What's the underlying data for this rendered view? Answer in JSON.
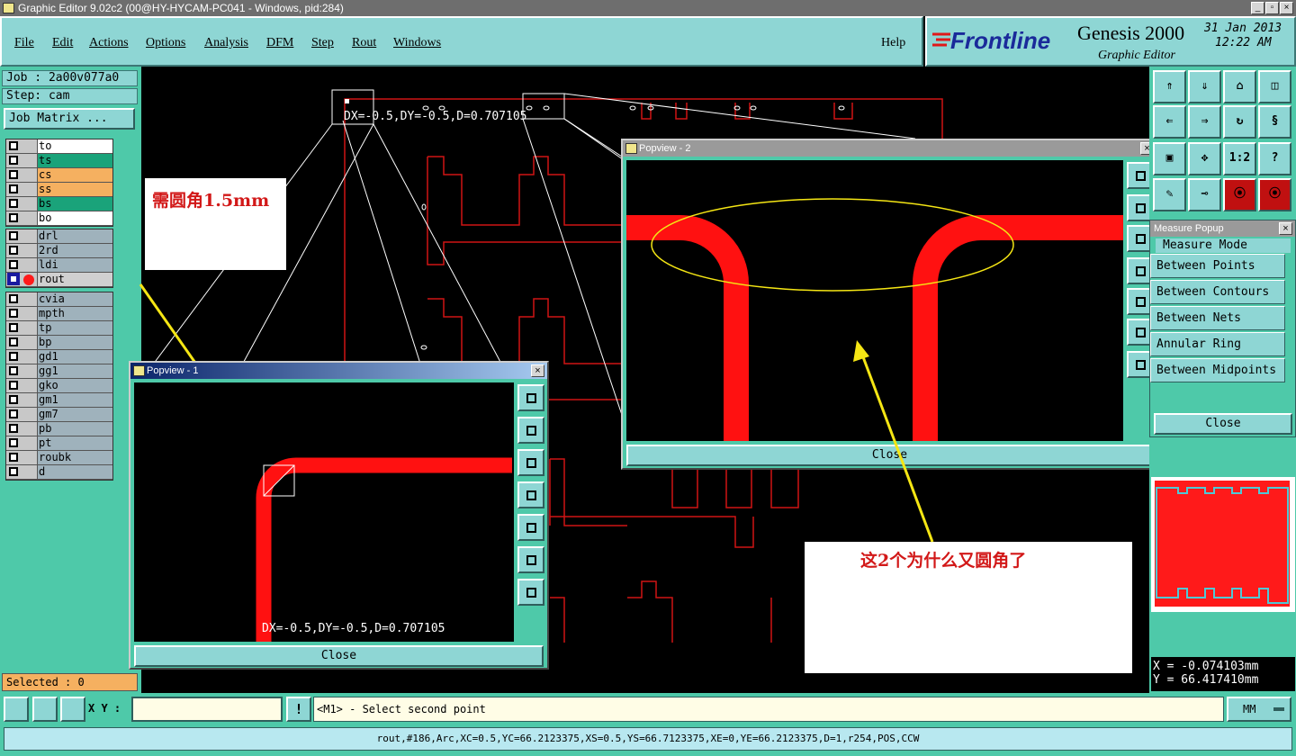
{
  "window": {
    "title": "Graphic Editor 9.02c2 (00@HY-HYCAM-PC041 - Windows, pid:284)"
  },
  "menu": {
    "items": [
      "File",
      "Edit",
      "Actions",
      "Options",
      "Analysis",
      "DFM",
      "Step",
      "Rout",
      "Windows"
    ],
    "help": "Help"
  },
  "brand": {
    "logo": "Frontline",
    "product": "Genesis 2000",
    "subtitle": "Graphic Editor",
    "date": "31 Jan 2013",
    "time": "12:22 AM"
  },
  "job": {
    "job_line": "Job : 2a00v077a0",
    "step_line": "Step: cam",
    "matrix_button": "Job Matrix ..."
  },
  "layers": {
    "group1": [
      "to",
      "ts",
      "cs",
      "ss",
      "bs",
      "bo"
    ],
    "group2": [
      "drl",
      "2rd",
      "ldi",
      "rout"
    ],
    "group3": [
      "cvia",
      "mpth",
      "tp",
      "bp",
      "gd1",
      "gg1",
      "gko",
      "gm1",
      "gm7",
      "pb",
      "pt",
      "roubk",
      "d"
    ],
    "colors": {
      "to": "#ffffff",
      "ts": "#1aa37a",
      "cs": "#f5b060",
      "ss": "#f5b060",
      "bs": "#1aa37a",
      "bo": "#ffffff",
      "drl": "#9fb2bc",
      "2rd": "#9fb2bc",
      "ldi": "#9fb2bc",
      "rout": "#d0d0d0"
    }
  },
  "selected": "Selected : 0",
  "canvas": {
    "measure_text": "DX=-0.5,DY=-0.5,D=0.707105"
  },
  "popview1": {
    "title": "Popview - 1",
    "measure_text": "DX=-0.5,DY=-0.5,D=0.707105",
    "close": "Close"
  },
  "popview2": {
    "title": "Popview - 2",
    "close": "Close"
  },
  "measure_popup": {
    "title": "Measure Popup",
    "header": "Measure Mode",
    "modes": [
      "Between Points",
      "Between Contours",
      "Between Nets",
      "Annular Ring",
      "Between Midpoints"
    ],
    "close": "Close"
  },
  "tools": {
    "ratio_label": "1:2",
    "help_label": "?"
  },
  "notes": {
    "left": "需圆角1.5mm",
    "right": "这2个为什么又圆角了"
  },
  "coords": {
    "x": "X = -0.074103mm",
    "y": "Y = 66.417410mm"
  },
  "status": {
    "xy_label": "X Y :",
    "xy_value": "",
    "prompt": "<M1> - Select second point",
    "units": "MM",
    "info": "rout,#186,Arc,XC=0.5,YC=66.2123375,XS=0.5,YS=66.7123375,XE=0,YE=66.2123375,D=1,r254,POS,CCW"
  }
}
